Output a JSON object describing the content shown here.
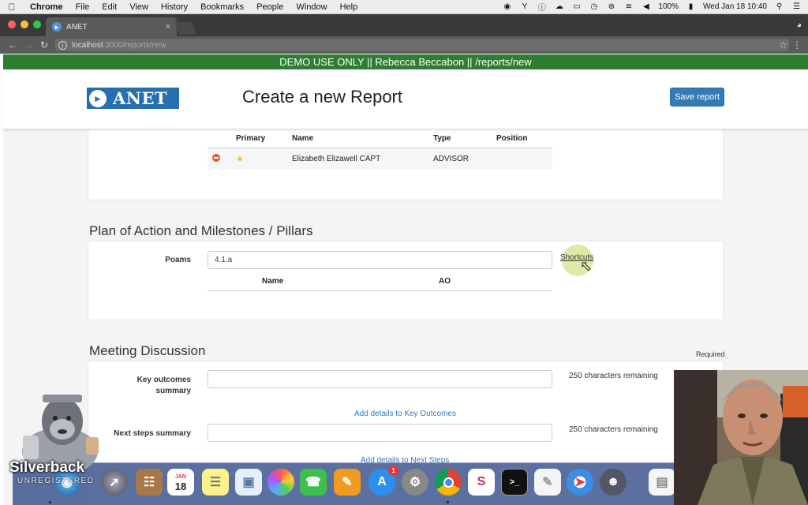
{
  "menubar": {
    "app_name": "Chrome",
    "items": [
      "File",
      "Edit",
      "View",
      "History",
      "Bookmarks",
      "People",
      "Window",
      "Help"
    ],
    "battery": "100%",
    "clock": "Wed Jan 18  10:40"
  },
  "browser": {
    "tab_title": "ANET",
    "tab_close": "×",
    "url_host": "localhost",
    "url_path": ":3000/reports/new"
  },
  "banner": {
    "text": "DEMO USE ONLY || Rebecca Beccabon || /reports/new"
  },
  "header": {
    "logo_text": "ANET",
    "title": "Create a new Report",
    "save_label": "Save report"
  },
  "attendees": {
    "columns": [
      "Primary",
      "Name",
      "Type",
      "Position"
    ],
    "rows": [
      {
        "name": "Elizabeth Elizawell CAPT",
        "type": "ADVISOR",
        "position": ""
      }
    ]
  },
  "poams_section": {
    "title": "Plan of Action and Milestones / Pillars",
    "label": "Poams",
    "input_value": "4.1.a",
    "shortcuts": "Shortcuts",
    "columns": [
      "Name",
      "AO"
    ]
  },
  "meeting_section": {
    "title": "Meeting Discussion",
    "required": "Required",
    "key_outcomes_label_1": "Key outcomes",
    "key_outcomes_label_2": "summary",
    "key_outcomes_remaining": "250 characters remaining",
    "key_outcomes_link": "Add details to Key Outcomes",
    "next_steps_label": "Next steps summary",
    "next_steps_remaining": "250 characters remaining",
    "next_steps_link": "Add details to Next Steps"
  },
  "overlay": {
    "silverback_name": "Silverback",
    "silverback_sub": "UNREGISTERED"
  },
  "dock": {
    "calendar_month": "JAN",
    "calendar_day": "18",
    "appstore_badge": "1",
    "apps": [
      "finder",
      "siri",
      "launchpad",
      "contacts",
      "calendar",
      "notes",
      "preview",
      "photos",
      "facetime",
      "ibooks",
      "app-store",
      "system-preferences",
      "chrome",
      "slack",
      "terminal",
      "textedit",
      "safari",
      "silverback",
      "documents"
    ]
  },
  "colors": {
    "banner": "#2e7d32",
    "primary_button": "#337ab7",
    "link": "#337ab7",
    "logo_bg": "#2670b0"
  }
}
